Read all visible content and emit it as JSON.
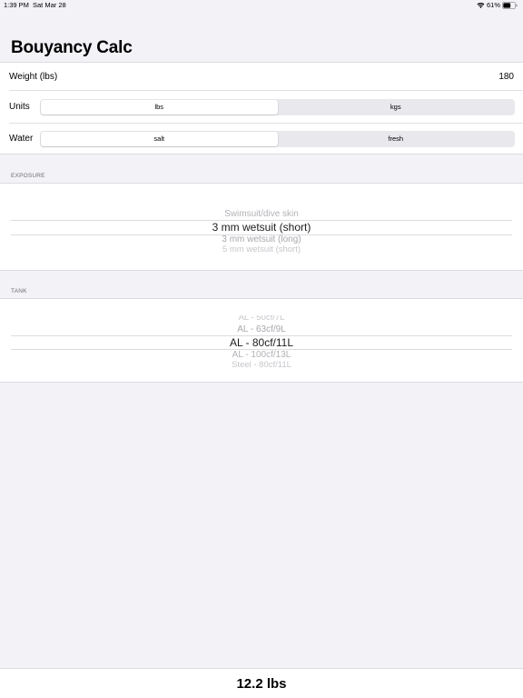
{
  "status_bar": {
    "time": "1:39 PM",
    "date": "Sat Mar 28",
    "battery": "61%"
  },
  "title": "Bouyancy Calc",
  "settings": {
    "weight": {
      "label": "Weight (lbs)",
      "value": "180"
    },
    "units": {
      "label": "Units",
      "options": [
        "lbs",
        "kgs"
      ],
      "selected": "lbs"
    },
    "water": {
      "label": "Water",
      "options": [
        "salt",
        "fresh"
      ],
      "selected": "salt"
    }
  },
  "exposure": {
    "header": "EXPOSURE",
    "items": [
      "Swimsuit/dive skin",
      "3 mm wetsuit (short)",
      "3 mm wetsuit (long)",
      "5 mm wetsuit (short)"
    ],
    "selected": "3 mm wetsuit (short)"
  },
  "tank": {
    "header": "TANK",
    "items": [
      "AL - 50cf/7L",
      "AL - 63cf/9L",
      "AL - 80cf/11L",
      "AL - 100cf/13L",
      "Steel - 80cf/11L"
    ],
    "selected": "AL - 80cf/11L"
  },
  "result": "12.2 lbs",
  "colors": {
    "background": "#f2f2f7",
    "segment_track": "#e8e8ed",
    "secondary_text": "#6e6e73"
  }
}
